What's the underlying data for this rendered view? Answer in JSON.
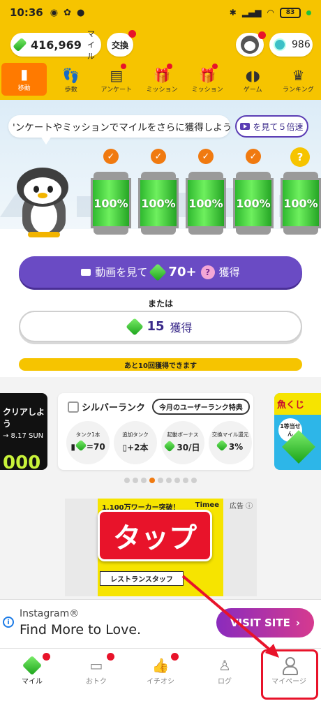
{
  "status_bar": {
    "time": "10:36",
    "battery": "83"
  },
  "header": {
    "miles_value": "416,969",
    "miles_unit": "マイル",
    "exchange_label": "交換",
    "coin_value": "986"
  },
  "tabs": [
    {
      "label": "移動",
      "icon": "battery-icon",
      "active": true
    },
    {
      "label": "歩数",
      "icon": "footprints-icon"
    },
    {
      "label": "アンケート",
      "icon": "survey-icon"
    },
    {
      "label": "ミッション",
      "icon": "gift-a-icon"
    },
    {
      "label": "ミッション",
      "icon": "gift-b-icon"
    },
    {
      "label": "ゲーム",
      "icon": "gamepad-icon"
    },
    {
      "label": "ランキング",
      "icon": "crown-icon"
    }
  ],
  "hero": {
    "bubble_text": "'ンケートやミッションでマイルをさらに獲得しよう",
    "video_button": "を見て５倍速",
    "tanks": [
      "100%",
      "100%",
      "100%",
      "100%",
      "100%"
    ],
    "next_tank_mark": "?",
    "main_cta_prefix": "動画を見て",
    "main_cta_amount": "70+",
    "main_cta_suffix": "獲得",
    "or_text": "または",
    "alt_cta_amount": "15",
    "alt_cta_suffix": "獲得",
    "remaining_text": "あと10回獲得できます"
  },
  "carousel": {
    "left_banner_text": "クリアしよう",
    "left_banner_date": "→ 8.17 SUN",
    "left_banner_big": "000",
    "rank_title": "シルバーランク",
    "rank_tag": "今月のユーザーランク特典",
    "perks": [
      {
        "label": "タンク1本",
        "value": "=70"
      },
      {
        "label": "追加タンク",
        "value": "+2本"
      },
      {
        "label": "起動ボーナス",
        "value": "30/日"
      },
      {
        "label": "交換マイル還元",
        "value": "3%"
      }
    ],
    "right_banner_title": "魚くじ",
    "right_banner_badge": "1等当せん",
    "dots_count": 9,
    "active_dot": 3
  },
  "ad": {
    "top_text": "1,100万ワーカー突破！",
    "brand": "Timee",
    "label": "広告",
    "sub_text": "レストランスタッフ",
    "tap_callout": "タップ"
  },
  "insta_banner": {
    "source": "Instagram®",
    "title": "Find More to Love.",
    "cta": "VISIT SITE"
  },
  "bottom_nav": [
    {
      "label": "マイル",
      "icon": "gem-icon",
      "dot": true,
      "active": true
    },
    {
      "label": "おトク",
      "icon": "ticket-icon",
      "dot": true
    },
    {
      "label": "イチオシ",
      "icon": "thumbs-up-icon",
      "dot": true
    },
    {
      "label": "ログ",
      "icon": "log-icon",
      "dot": false
    },
    {
      "label": "マイページ",
      "icon": "person-icon",
      "dot": false
    }
  ],
  "colors": {
    "brand_yellow": "#f6c400",
    "accent_orange": "#ff7a00",
    "cta_purple": "#6a4bc4",
    "alert_red": "#e8132a"
  }
}
